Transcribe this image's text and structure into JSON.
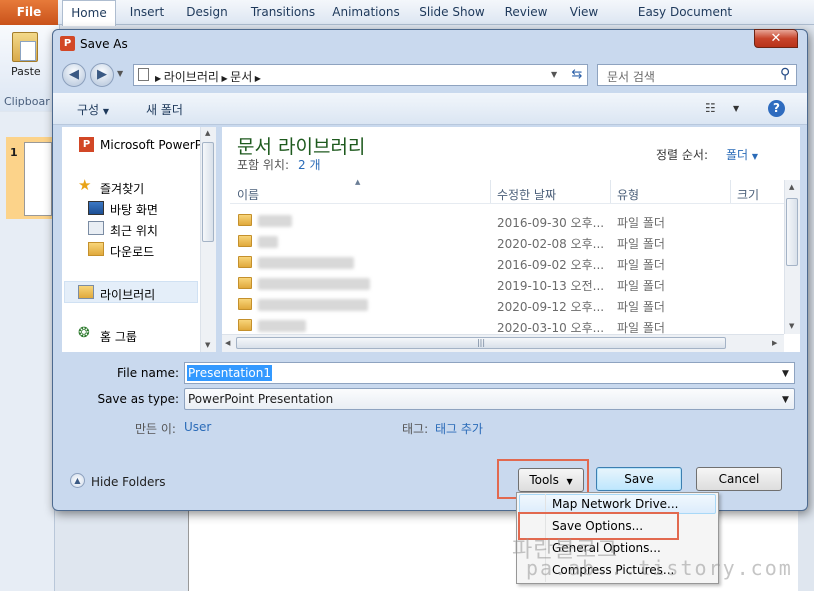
{
  "ribbon": {
    "file_tab": "File",
    "tabs": [
      "Home",
      "Insert",
      "Design",
      "Transitions",
      "Animations",
      "Slide Show",
      "Review",
      "View",
      "Easy Document Creator"
    ],
    "paste_label": "Paste",
    "clipboard_label": "Clipboar"
  },
  "slides": {
    "slide_number": "1"
  },
  "dialog": {
    "title": "Save As",
    "title_icon": "P",
    "close_glyph": "✕",
    "breadcrumb": [
      "라이브러리",
      "문서"
    ],
    "search_placeholder": "문서 검색",
    "toolbar": {
      "organize_label": "구성",
      "new_folder_label": "새 폴더"
    },
    "nav_tree": {
      "app_item": "Microsoft PowerPo",
      "favorites": "즐겨찾기",
      "fav_items": [
        "바탕 화면",
        "최근 위치",
        "다운로드"
      ],
      "libraries": "라이브러리",
      "homegroup": "홈 그룹"
    },
    "library": {
      "title": "문서 라이브러리",
      "includes_label": "포함 위치:",
      "includes_count": "2 개",
      "sort_label": "정렬 순서:",
      "sort_value": "폴더"
    },
    "columns": [
      "이름",
      "수정한 날짜",
      "유형",
      "크기"
    ],
    "rows": [
      {
        "date": "2016-09-30 오후...",
        "type": "파일 폴더"
      },
      {
        "date": "2020-02-08 오후...",
        "type": "파일 폴더"
      },
      {
        "date": "2016-09-02 오후...",
        "type": "파일 폴더"
      },
      {
        "date": "2019-10-13 오전...",
        "type": "파일 폴더"
      },
      {
        "date": "2020-09-12 오후...",
        "type": "파일 폴더"
      },
      {
        "date": "2020-03-10 오후...",
        "type": "파일 폴더"
      }
    ],
    "form": {
      "file_name_label": "File name:",
      "file_name_value": "Presentation1",
      "save_type_label": "Save as type:",
      "save_type_value": "PowerPoint Presentation",
      "authors_label": "만든 이:",
      "authors_value": "User",
      "tags_label": "태그:",
      "tags_value": "태그 추가"
    },
    "hide_folders": "Hide Folders",
    "buttons": {
      "tools": "Tools",
      "save": "Save",
      "cancel": "Cancel"
    },
    "tools_menu": [
      "Map Network Drive...",
      "Save Options...",
      "General Options...",
      "Compress Pictures..."
    ]
  },
  "watermark": {
    "line1": "파란블로그",
    "line2": "pa.ab...tistory.com"
  },
  "colors": {
    "file_tab": "#d0581e",
    "highlight_box": "#e2694f",
    "selection": "#3399ff",
    "library_title": "#1e5a1e",
    "link": "#2a6bb8"
  }
}
